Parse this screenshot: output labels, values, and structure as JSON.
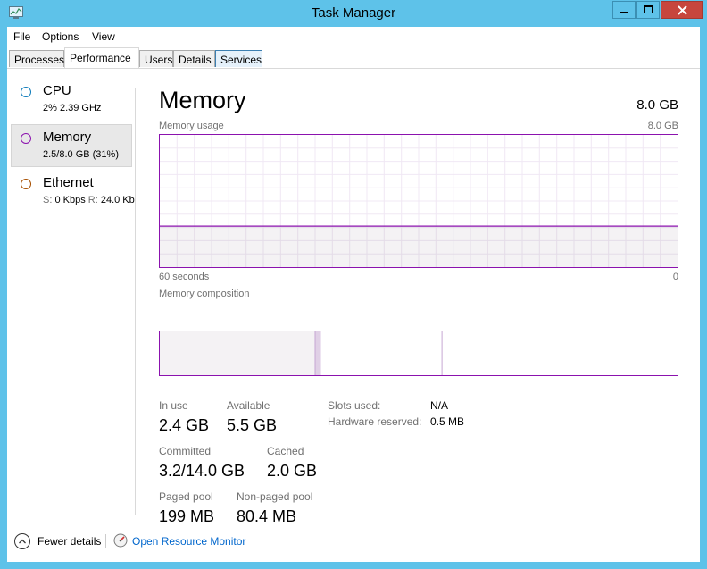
{
  "window": {
    "title": "Task Manager",
    "controls": {
      "minimize": "minimize-icon",
      "maximize": "maximize-icon",
      "close": "close-icon"
    }
  },
  "menu": [
    "File",
    "Options",
    "View"
  ],
  "tabs": [
    {
      "label": "Processes"
    },
    {
      "label": "Performance",
      "active": true
    },
    {
      "label": "Users"
    },
    {
      "label": "Details"
    },
    {
      "label": "Services"
    }
  ],
  "sidebar": {
    "items": [
      {
        "name": "CPU",
        "detail": "2% 2.39 GHz",
        "color": "#117dbb"
      },
      {
        "name": "Memory",
        "detail": "2.5/8.0 GB (31%)",
        "color": "#8b12ae",
        "selected": true
      },
      {
        "name": "Ethernet",
        "detail_s_label": "S:",
        "detail_s": "0 Kbps",
        "detail_r_label": "R:",
        "detail_r": "24.0 Kb",
        "color": "#a74f01"
      }
    ]
  },
  "memory": {
    "title": "Memory",
    "total": "8.0 GB",
    "usage_label": "Memory usage",
    "usage_max": "8.0 GB",
    "time_left": "60 seconds",
    "time_right": "0",
    "usage_fraction": 0.31,
    "composition_label": "Memory composition",
    "composition": {
      "in_use_fraction": 0.3,
      "modified_fraction": 0.01,
      "standby_fraction": 0.235,
      "accent_color": "#8b12ae"
    },
    "stats": {
      "in_use_label": "In use",
      "in_use": "2.4 GB",
      "available_label": "Available",
      "available": "5.5 GB",
      "committed_label": "Committed",
      "committed": "3.2/14.0 GB",
      "cached_label": "Cached",
      "cached": "2.0 GB",
      "paged_label": "Paged pool",
      "paged": "199 MB",
      "nonpaged_label": "Non-paged pool",
      "nonpaged": "80.4 MB"
    },
    "info": {
      "slots_label": "Slots used:",
      "slots": "N/A",
      "hw_label": "Hardware reserved:",
      "hw": "0.5 MB"
    }
  },
  "footer": {
    "fewer": "Fewer details",
    "resource_monitor": "Open Resource Monitor"
  }
}
